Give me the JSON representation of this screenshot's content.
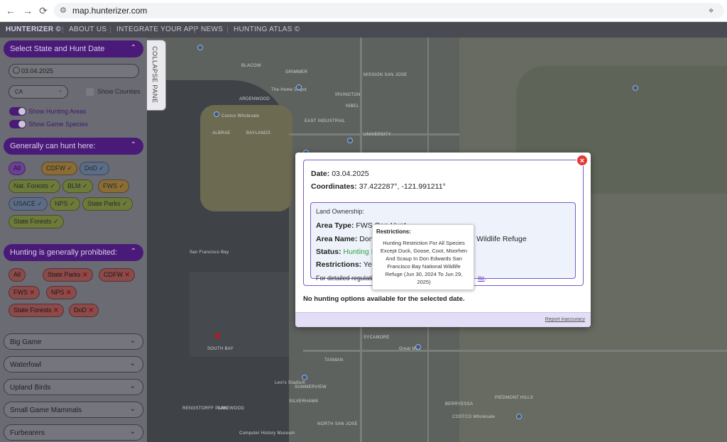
{
  "browser": {
    "url": "map.hunterizer.com",
    "back_icon": "←",
    "forward_icon": "→",
    "reload_icon": "⟳",
    "tune_icon": "⚙",
    "location_icon": "⌖"
  },
  "topnav": {
    "brand": "HUNTERIZER ©",
    "items": [
      "ABOUT US",
      "INTEGRATE YOUR APP",
      "NEWS",
      "HUNTING ATLAS ©"
    ]
  },
  "collapse_label": "COLLAPSE PANE",
  "sidebar": {
    "select_header": "Select State and Hunt Date",
    "date_value": "03.04.2025",
    "state_value": "CA",
    "show_counties": "Show Counties",
    "show_hunting_areas": "Show Hunting Areas",
    "show_game_species": "Show Game Species",
    "can_hunt_header": "Generally can hunt here:",
    "can_hunt_chips": [
      "All",
      "CDFW ✓",
      "DoD ✓",
      "Nat. Forests ✓",
      "BLM ✓",
      "FWS ✓",
      "USACE ✓",
      "NPS ✓",
      "State Parks ✓",
      "State Forests ✓"
    ],
    "prohibited_header": "Hunting is generally prohibited:",
    "prohibited_chips": [
      "All",
      "State Parks",
      "CDFW",
      "FWS",
      "NPS",
      "State Forests",
      "DoD"
    ],
    "prohibited_mark": "✕",
    "chevron_up": "⌃",
    "chevron_down": "⌄",
    "categories": [
      "Big Game",
      "Waterfowl",
      "Upland Birds",
      "Small Game Mammals",
      "Furbearers"
    ]
  },
  "map": {
    "labels": [
      "BLACOW",
      "GRIMMER",
      "IRVINGTON",
      "The Home Depot",
      "ARDENWOOD",
      "Costco Wholesale",
      "ALBRAE",
      "BAYLANDS",
      "EAST INDUSTRIAL",
      "MISSION SAN JOSE",
      "NIBEL",
      "UNIVERSITY",
      "SOUTH BAY",
      "SYCAMORE",
      "Great Mall",
      "SUMMERVIEW",
      "SILVERHAWK",
      "TASMAN",
      "Levi's Stadium",
      "BERRYESSA",
      "PIEDMONT HILLS",
      "COSTCO Wholesale",
      "NORTH SAN JOSE",
      "RENGSTORFF PARK",
      "LAKEWOOD",
      "Computer History Museum",
      "San Francisco Bay"
    ]
  },
  "popup": {
    "close_icon": "×",
    "date_label": "Date:",
    "date_value": "03.04.2025",
    "coords_label": "Coordinates:",
    "coords_value": "37.422287°, -121.991211°",
    "ownership_title": "Land Ownership:",
    "area_type_label": "Area Type:",
    "area_type_value": "FWS Can Hunt",
    "area_name_label": "Area Name:",
    "area_name_start": "Don E",
    "area_name_end": "al Wildlife Refuge",
    "status_label": "Status:",
    "status_value": "Hunting Is",
    "restrictions_label": "Restrictions:",
    "restrictions_value": "Yes",
    "regulations_prefix": "For detailed regulatio",
    "regulations_link": "ite",
    "regulations_suffix": ".",
    "no_options": "No hunting options available for the selected date.",
    "report": "Report inaccuracy"
  },
  "tooltip": {
    "title": "Restrictions:",
    "body": "Hunting Restriction For All Species Except Duck, Goose, Coot, Moorhen And Scaup In Don Edwards San Francisco Bay National Wildlife Refuge (Jun 30, 2024 To Jun 29, 2025)"
  }
}
